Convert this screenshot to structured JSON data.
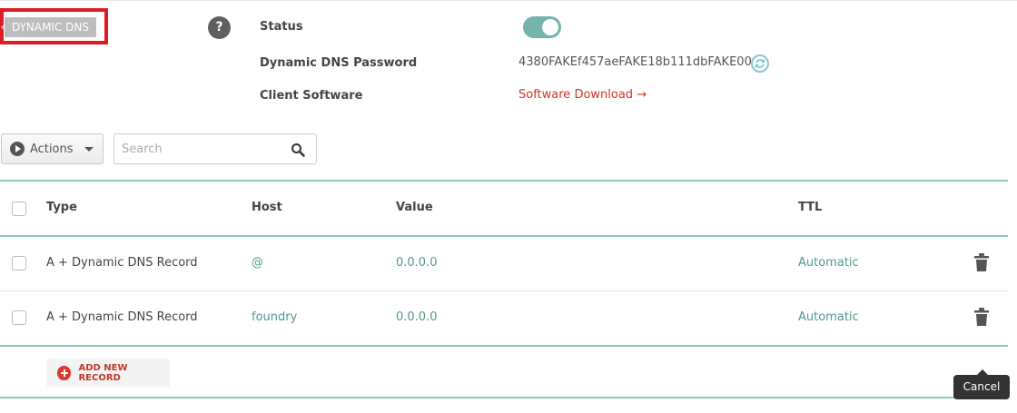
{
  "section": {
    "tag": "DYNAMIC DNS",
    "help": "?"
  },
  "settings": {
    "status_label": "Status",
    "status_on": true,
    "password_label": "Dynamic DNS Password",
    "password_value": "4380FAKEf457aeFAKE18b111dbFAKE00",
    "client_label": "Client Software",
    "client_link": "Software Download →"
  },
  "toolbar": {
    "actions_label": "Actions",
    "search_placeholder": "Search"
  },
  "table": {
    "headers": {
      "type": "Type",
      "host": "Host",
      "value": "Value",
      "ttl": "TTL"
    },
    "rows": [
      {
        "type": "A + Dynamic DNS Record",
        "host": "@",
        "value": "0.0.0.0",
        "ttl": "Automatic"
      },
      {
        "type": "A + Dynamic DNS Record",
        "host": "foundry",
        "value": "0.0.0.0",
        "ttl": "Automatic"
      }
    ]
  },
  "add_record_label": "ADD NEW RECORD",
  "tooltip": {
    "cancel": "Cancel"
  },
  "colors": {
    "accent": "#73b4ad",
    "link": "#d3332a",
    "highlight": "#e01b24"
  }
}
